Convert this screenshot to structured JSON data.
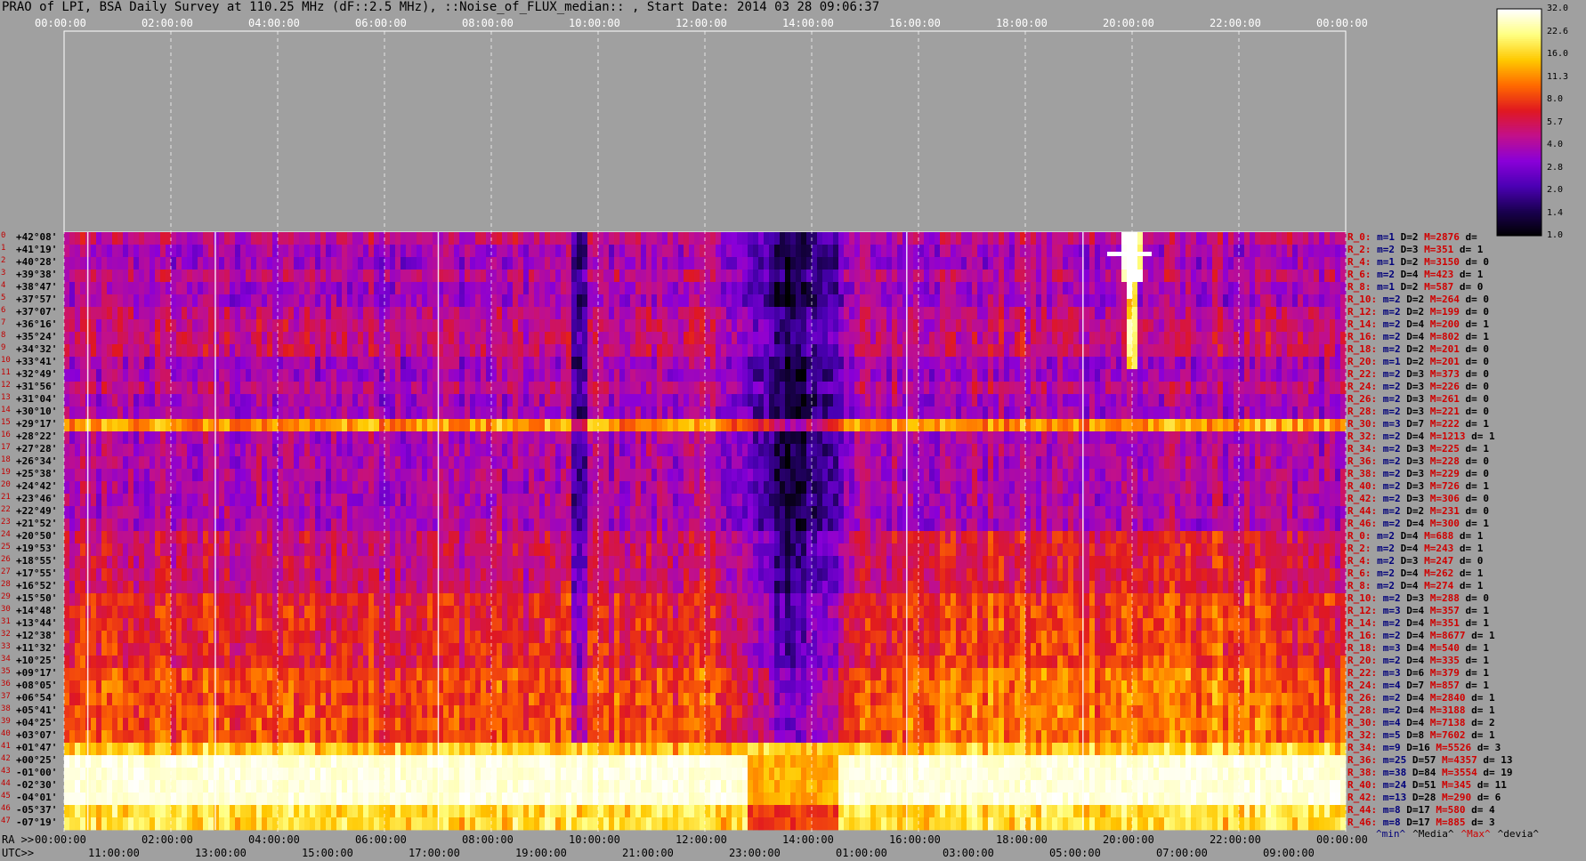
{
  "title": "PRAO of LPI, BSA Daily Survey at 110.25 MHz (dF::2.5 MHz), ::Noise_of_FLUX_median:: , Start Date: 2014 03 28 09:06:37",
  "colors": {
    "background": "#a0a0a0",
    "colormap": [
      "#000000",
      "#1a0050",
      "#4b00b4",
      "#8a00d8",
      "#c2108a",
      "#e01820",
      "#ff6a00",
      "#ffc800",
      "#ffff80",
      "#ffffff"
    ]
  },
  "utc_top_ticks": [
    "00:00:00",
    "02:00:00",
    "04:00:00",
    "06:00:00",
    "08:00:00",
    "10:00:00",
    "12:00:00",
    "14:00:00",
    "16:00:00",
    "18:00:00",
    "20:00:00",
    "22:00:00",
    "00:00:00"
  ],
  "ra_bottom_ticks": [
    "00:00:00",
    "02:00:00",
    "04:00:00",
    "06:00:00",
    "08:00:00",
    "10:00:00",
    "12:00:00",
    "14:00:00",
    "16:00:00",
    "18:00:00",
    "20:00:00",
    "22:00:00",
    "00:00:00"
  ],
  "utc_bottom_ticks": [
    "11:00:00",
    "13:00:00",
    "15:00:00",
    "17:00:00",
    "19:00:00",
    "21:00:00",
    "23:00:00",
    "01:00:00",
    "03:00:00",
    "05:00:00",
    "07:00:00",
    "09:00:00"
  ],
  "axis_prefix": {
    "ra": "RA >>",
    "utc": "UTC>>"
  },
  "declinations": [
    "+42°08'",
    "+41°19'",
    "+40°28'",
    "+39°38'",
    "+38°47'",
    "+37°57'",
    "+37°07'",
    "+36°16'",
    "+35°24'",
    "+34°32'",
    "+33°41'",
    "+32°49'",
    "+31°56'",
    "+31°04'",
    "+30°10'",
    "+29°17'",
    "+28°22'",
    "+27°28'",
    "+26°34'",
    "+25°38'",
    "+24°42'",
    "+23°46'",
    "+22°49'",
    "+21°52'",
    "+20°50'",
    "+19°53'",
    "+18°55'",
    "+17°55'",
    "+16°52'",
    "+15°50'",
    "+14°48'",
    "+13°44'",
    "+12°38'",
    "+11°32'",
    "+10°25'",
    "+09°17'",
    "+08°05'",
    "+06°54'",
    "+05°41'",
    "+04°25'",
    "+03°07'",
    "+01°47'",
    "+00°25'",
    "-01°00'",
    "-02°30'",
    "-04°01'",
    "-05°37'",
    "-07°19'"
  ],
  "colorbar": {
    "ticks": [
      "32.0",
      "22.6",
      "16.0",
      "11.3",
      "8.0",
      "5.7",
      "4.0",
      "2.8",
      "2.0",
      "1.4",
      "1.0"
    ]
  },
  "stats": [
    {
      "r": "R_0:",
      "m": "m=1",
      "d": "D=2",
      "M": "M=2876",
      "dv": "d="
    },
    {
      "r": "R_2:",
      "m": "m=2",
      "d": "D=3",
      "M": "M=351",
      "dv": "d= 1"
    },
    {
      "r": "R_4:",
      "m": "m=1",
      "d": "D=2",
      "M": "M=3150",
      "dv": "d= 0"
    },
    {
      "r": "R_6:",
      "m": "m=2",
      "d": "D=4",
      "M": "M=423",
      "dv": "d= 1"
    },
    {
      "r": "R_8:",
      "m": "m=1",
      "d": "D=2",
      "M": "M=587",
      "dv": "d= 0"
    },
    {
      "r": "R_10:",
      "m": "m=2",
      "d": "D=2",
      "M": "M=264",
      "dv": "d= 0"
    },
    {
      "r": "R_12:",
      "m": "m=2",
      "d": "D=2",
      "M": "M=199",
      "dv": "d= 0"
    },
    {
      "r": "R_14:",
      "m": "m=2",
      "d": "D=4",
      "M": "M=200",
      "dv": "d= 1"
    },
    {
      "r": "R_16:",
      "m": "m=2",
      "d": "D=4",
      "M": "M=802",
      "dv": "d= 1"
    },
    {
      "r": "R_18:",
      "m": "m=2",
      "d": "D=2",
      "M": "M=201",
      "dv": "d= 0"
    },
    {
      "r": "R_20:",
      "m": "m=1",
      "d": "D=2",
      "M": "M=201",
      "dv": "d= 0"
    },
    {
      "r": "R_22:",
      "m": "m=2",
      "d": "D=3",
      "M": "M=373",
      "dv": "d= 0"
    },
    {
      "r": "R_24:",
      "m": "m=2",
      "d": "D=3",
      "M": "M=226",
      "dv": "d= 0"
    },
    {
      "r": "R_26:",
      "m": "m=2",
      "d": "D=3",
      "M": "M=261",
      "dv": "d= 0"
    },
    {
      "r": "R_28:",
      "m": "m=2",
      "d": "D=3",
      "M": "M=221",
      "dv": "d= 0"
    },
    {
      "r": "R_30:",
      "m": "m=3",
      "d": "D=7",
      "M": "M=222",
      "dv": "d= 1"
    },
    {
      "r": "R_32:",
      "m": "m=2",
      "d": "D=4",
      "M": "M=1213",
      "dv": "d= 1"
    },
    {
      "r": "R_34:",
      "m": "m=2",
      "d": "D=3",
      "M": "M=225",
      "dv": "d= 1"
    },
    {
      "r": "R_36:",
      "m": "m=2",
      "d": "D=3",
      "M": "M=228",
      "dv": "d= 0"
    },
    {
      "r": "R_38:",
      "m": "m=2",
      "d": "D=3",
      "M": "M=229",
      "dv": "d= 0"
    },
    {
      "r": "R_40:",
      "m": "m=2",
      "d": "D=3",
      "M": "M=726",
      "dv": "d= 1"
    },
    {
      "r": "R_42:",
      "m": "m=2",
      "d": "D=3",
      "M": "M=306",
      "dv": "d= 0"
    },
    {
      "r": "R_44:",
      "m": "m=2",
      "d": "D=2",
      "M": "M=231",
      "dv": "d= 0"
    },
    {
      "r": "R_46:",
      "m": "m=2",
      "d": "D=4",
      "M": "M=300",
      "dv": "d= 1"
    },
    {
      "r": "R_0:",
      "m": "m=2",
      "d": "D=4",
      "M": "M=688",
      "dv": "d= 1"
    },
    {
      "r": "R_2:",
      "m": "m=2",
      "d": "D=4",
      "M": "M=243",
      "dv": "d= 1"
    },
    {
      "r": "R_4:",
      "m": "m=2",
      "d": "D=3",
      "M": "M=247",
      "dv": "d= 0"
    },
    {
      "r": "R_6:",
      "m": "m=2",
      "d": "D=4",
      "M": "M=262",
      "dv": "d= 1"
    },
    {
      "r": "R_8:",
      "m": "m=2",
      "d": "D=4",
      "M": "M=274",
      "dv": "d= 1"
    },
    {
      "r": "R_10:",
      "m": "m=2",
      "d": "D=3",
      "M": "M=288",
      "dv": "d= 0"
    },
    {
      "r": "R_12:",
      "m": "m=3",
      "d": "D=4",
      "M": "M=357",
      "dv": "d= 1"
    },
    {
      "r": "R_14:",
      "m": "m=2",
      "d": "D=4",
      "M": "M=351",
      "dv": "d= 1"
    },
    {
      "r": "R_16:",
      "m": "m=2",
      "d": "D=4",
      "M": "M=8677",
      "dv": "d= 1"
    },
    {
      "r": "R_18:",
      "m": "m=3",
      "d": "D=4",
      "M": "M=540",
      "dv": "d= 1"
    },
    {
      "r": "R_20:",
      "m": "m=2",
      "d": "D=4",
      "M": "M=335",
      "dv": "d= 1"
    },
    {
      "r": "R_22:",
      "m": "m=3",
      "d": "D=6",
      "M": "M=379",
      "dv": "d= 1"
    },
    {
      "r": "R_24:",
      "m": "m=4",
      "d": "D=7",
      "M": "M=857",
      "dv": "d= 1"
    },
    {
      "r": "R_26:",
      "m": "m=2",
      "d": "D=4",
      "M": "M=2840",
      "dv": "d= 1"
    },
    {
      "r": "R_28:",
      "m": "m=2",
      "d": "D=4",
      "M": "M=3188",
      "dv": "d= 1"
    },
    {
      "r": "R_30:",
      "m": "m=4",
      "d": "D=4",
      "M": "M=7138",
      "dv": "d= 2"
    },
    {
      "r": "R_32:",
      "m": "m=5",
      "d": "D=8",
      "M": "M=7602",
      "dv": "d= 1"
    },
    {
      "r": "R_34:",
      "m": "m=9",
      "d": "D=16",
      "M": "M=5526",
      "dv": "d= 3"
    },
    {
      "r": "R_36:",
      "m": "m=25",
      "d": "D=57",
      "M": "M=4357",
      "dv": "d= 13"
    },
    {
      "r": "R_38:",
      "m": "m=38",
      "d": "D=84",
      "M": "M=3554",
      "dv": "d= 19"
    },
    {
      "r": "R_40:",
      "m": "m=24",
      "d": "D=51",
      "M": "M=345",
      "dv": "d= 11"
    },
    {
      "r": "R_42:",
      "m": "m=13",
      "d": "D=28",
      "M": "M=290",
      "dv": "d= 6"
    },
    {
      "r": "R_44:",
      "m": "m=8",
      "d": "D=17",
      "M": "M=580",
      "dv": "d= 4"
    },
    {
      "r": "R_46:",
      "m": "m=8",
      "d": "D=17",
      "M": "M=885",
      "dv": "d= 3"
    }
  ],
  "legend_footer": {
    "min": "^min^",
    "media": "^Media^",
    "max": "^Max^",
    "devia": "^devia^"
  },
  "chart_data": {
    "type": "heatmap",
    "title": "PRAO of LPI, BSA Daily Survey at 110.25 MHz (dF::2.5 MHz), ::Noise_of_FLUX_median:: , Start Date: 2014 03 28 09:06:37",
    "x_axis": {
      "quantity": "RA / UTC",
      "range_hours": [
        0,
        24
      ]
    },
    "y_axis": {
      "rows": 48,
      "first": "+42°08'",
      "last": "-07°19'"
    },
    "colorbar_range": [
      1.0,
      32.0
    ],
    "colorbar_scale": "log",
    "note_values": "noise flux median per beam per time; bright band near beams 33-45 (Galactic plane / Sun region), dark minimum around RA 13h-14h, bright source near RA 20h at +40°"
  }
}
